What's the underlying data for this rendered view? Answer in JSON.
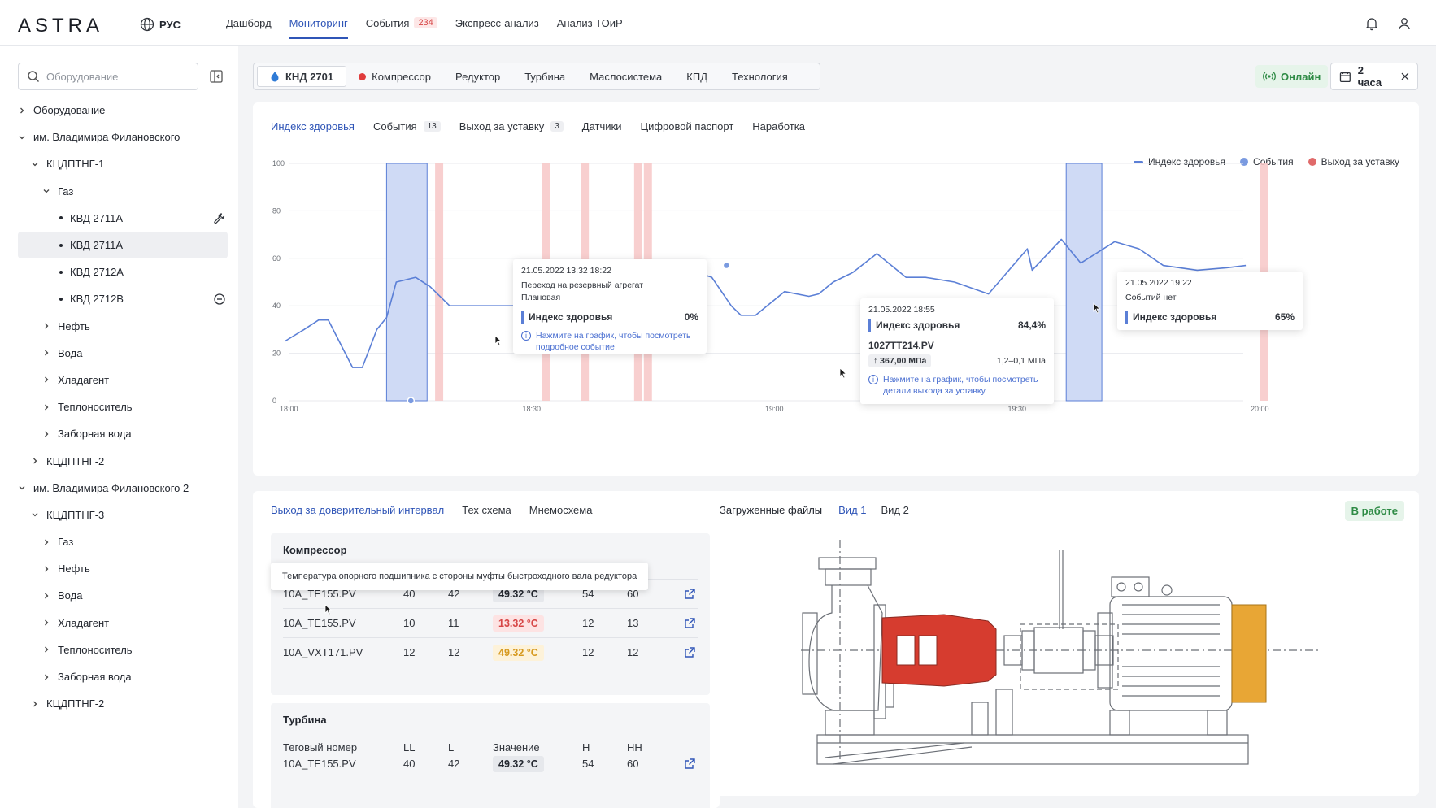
{
  "header": {
    "logo": "ASTRA",
    "lang": "РУС",
    "nav": [
      {
        "label": "Дашборд",
        "active": false
      },
      {
        "label": "Мониторинг",
        "active": true
      },
      {
        "label": "События",
        "badge": "234",
        "active": false
      },
      {
        "label": "Экспресс-анализ",
        "active": false
      },
      {
        "label": "Анализ ТОиР",
        "active": false
      }
    ],
    "icons": [
      "bell-icon",
      "user-icon"
    ]
  },
  "sidebar": {
    "search_placeholder": "Оборудование",
    "tree": [
      {
        "label": "Оборудование",
        "level": 0,
        "chev": "›"
      },
      {
        "label": "им. Владимира Филановского",
        "level": 0,
        "chev": "⌄"
      },
      {
        "label": "КЦДПТНГ-1",
        "level": 1,
        "chev": "⌄"
      },
      {
        "label": "Газ",
        "level": 2,
        "chev": "⌄"
      },
      {
        "label": "КВД 2711А",
        "level": 3,
        "dot": true,
        "icon": "wrench-icon"
      },
      {
        "label": "КВД 2711А",
        "level": 3,
        "dot": true,
        "selected": true
      },
      {
        "label": "КВД 2712А",
        "level": 3,
        "dot": true
      },
      {
        "label": "КВД 2712В",
        "level": 3,
        "dot": true,
        "icon": "minus-circle-icon"
      },
      {
        "label": "Нефть",
        "level": 2,
        "chev": "›"
      },
      {
        "label": "Вода",
        "level": 2,
        "chev": "›"
      },
      {
        "label": "Хладагент",
        "level": 2,
        "chev": "›"
      },
      {
        "label": "Теплоноситель",
        "level": 2,
        "chev": "›"
      },
      {
        "label": "Заборная вода",
        "level": 2,
        "chev": "›"
      },
      {
        "label": "КЦДПТНГ-2",
        "level": 1,
        "chev": "›"
      },
      {
        "label": "им. Владимира Филановского 2",
        "level": 0,
        "chev": "⌄"
      },
      {
        "label": "КЦДПТНГ-3",
        "level": 1,
        "chev": "⌄"
      },
      {
        "label": "Газ",
        "level": 2,
        "chev": "›"
      },
      {
        "label": "Нефть",
        "level": 2,
        "chev": "›"
      },
      {
        "label": "Вода",
        "level": 2,
        "chev": "›"
      },
      {
        "label": "Хладагент",
        "level": 2,
        "chev": "›"
      },
      {
        "label": "Теплоноситель",
        "level": 2,
        "chev": "›"
      },
      {
        "label": "Заборная вода",
        "level": 2,
        "chev": "›"
      },
      {
        "label": "КЦДПТНГ-2",
        "level": 1,
        "chev": "›"
      }
    ]
  },
  "equipment_tabs": [
    {
      "label": "КНД 2701",
      "active": true,
      "icon": "flame-icon"
    },
    {
      "label": "Компрессор",
      "icon": "red-dot-icon"
    },
    {
      "label": "Редуктор"
    },
    {
      "label": "Турбина"
    },
    {
      "label": "Маслосистема"
    },
    {
      "label": "КПД"
    },
    {
      "label": "Технология"
    }
  ],
  "status": {
    "online": "Онлайн",
    "period": "2 часа"
  },
  "chart_tabs": [
    {
      "label": "Индекс здоровья",
      "active": true
    },
    {
      "label": "События",
      "count": "13"
    },
    {
      "label": "Выход за уставку",
      "count": "3"
    },
    {
      "label": "Датчики"
    },
    {
      "label": "Цифровой паспорт"
    },
    {
      "label": "Наработка"
    }
  ],
  "legend": [
    {
      "label": "Индекс здоровья",
      "type": "line",
      "color": "#5b7fd6"
    },
    {
      "label": "События",
      "type": "dot",
      "color": "#7a9ae0"
    },
    {
      "label": "Выход за уставку",
      "type": "dot",
      "color": "#e06a6a"
    }
  ],
  "chart_data": {
    "type": "line",
    "x_ticks": [
      "18:00",
      "18:30",
      "19:00",
      "19:30",
      "20:00"
    ],
    "y_ticks": [
      "0",
      "20",
      "40",
      "60",
      "80",
      "100"
    ],
    "ylim": [
      0,
      100
    ],
    "xlim_minutes": [
      0,
      120
    ],
    "series": [
      {
        "name": "Индекс здоровья",
        "points": [
          [
            -1,
            25
          ],
          [
            3,
            30
          ],
          [
            6,
            34
          ],
          [
            8,
            34
          ],
          [
            13,
            14
          ],
          [
            15,
            14
          ],
          [
            18,
            30
          ],
          [
            20,
            35
          ],
          [
            22,
            50
          ],
          [
            26,
            52
          ],
          [
            29,
            48
          ],
          [
            33,
            40
          ],
          [
            51,
            40
          ],
          [
            56,
            45
          ],
          [
            59,
            47
          ],
          [
            63,
            52
          ],
          [
            65,
            56
          ],
          [
            70,
            53
          ],
          [
            74,
            46
          ],
          [
            77,
            49
          ],
          [
            80,
            41
          ],
          [
            84,
            54
          ],
          [
            87,
            52
          ],
          [
            91,
            40
          ],
          [
            93,
            36
          ],
          [
            96,
            36
          ],
          [
            99,
            41
          ],
          [
            102,
            46
          ],
          [
            107,
            44
          ],
          [
            109,
            45
          ],
          [
            112,
            50
          ],
          [
            115,
            53
          ],
          [
            116,
            54
          ],
          [
            121,
            62
          ],
          [
            127,
            52
          ],
          [
            131,
            52
          ],
          [
            137,
            50
          ],
          [
            144,
            45
          ],
          [
            152,
            64
          ],
          [
            153,
            55
          ],
          [
            159,
            68
          ],
          [
            163,
            58
          ],
          [
            170,
            67
          ],
          [
            175,
            64
          ],
          [
            180,
            57
          ],
          [
            187,
            55
          ],
          [
            193,
            56
          ],
          [
            197,
            57
          ]
        ]
      }
    ],
    "events_bands": [
      [
        20,
        25
      ],
      [
        160,
        164
      ]
    ],
    "setpoint_bands": [
      [
        30,
        31
      ],
      [
        52,
        53
      ],
      [
        60,
        61
      ],
      [
        71,
        72
      ],
      [
        73,
        74
      ],
      [
        200,
        201
      ]
    ],
    "event_markers": [
      [
        23,
        0
      ],
      [
        60,
        35
      ],
      [
        88,
        57
      ]
    ]
  },
  "tooltips": {
    "t1": {
      "date": "21.05.2022 13:32 18:22",
      "line1": "Переход на резервный агрегат",
      "line2": "Плановая",
      "metric": "Индекс здоровья",
      "value": "0%",
      "hint": "Нажмите на график, чтобы посмотреть подробное событие"
    },
    "t2": {
      "date": "21.05.2022 18:55",
      "metric": "Индекс здоровья",
      "value": "84,4%",
      "tag": "1027TT214.PV",
      "reading": "367,00 МПа",
      "range": "1,2–0,1 МПа",
      "hint": "Нажмите на график, чтобы посмотреть детали выхода за уставку"
    },
    "t3": {
      "date": "21.05.2022 19:22",
      "line1": "Событий нет",
      "metric": "Индекс здоровья",
      "value": "65%"
    }
  },
  "bottom_left": {
    "tabs": [
      {
        "label": "Выход за доверительный интервал",
        "active": true
      },
      {
        "label": "Тех схема"
      },
      {
        "label": "Мнемосхема"
      }
    ],
    "sensor_tooltip": "Температура опорного подшипника с стороны муфты быстроходного вала редуктора",
    "sections": [
      {
        "title": "Компрессор",
        "rows": [
          {
            "tag": "10A_TE155.PV",
            "ll": "40",
            "l": "42",
            "value": "49.32 °C",
            "tone": "gray",
            "h": "54",
            "hh": "60"
          },
          {
            "tag": "10A_TE155.PV",
            "ll": "10",
            "l": "11",
            "value": "13.32 °C",
            "tone": "red",
            "h": "12",
            "hh": "13"
          },
          {
            "tag": "10A_VXT171.PV",
            "ll": "12",
            "l": "12",
            "value": "49.32 °C",
            "tone": "yellow",
            "h": "12",
            "hh": "12"
          }
        ]
      },
      {
        "title": "Турбина",
        "header": {
          "tag": "Теговый номер",
          "ll": "LL",
          "l": "L",
          "value": "Значение",
          "h": "H",
          "hh": "HH"
        },
        "rows": [
          {
            "tag": "10A_TE155.PV",
            "ll": "40",
            "l": "42",
            "value": "49.32 °C",
            "tone": "gray",
            "h": "54",
            "hh": "60"
          }
        ]
      }
    ]
  },
  "bottom_right": {
    "tabs": [
      {
        "label": "Загруженные файлы",
        "active": false
      },
      {
        "label": "Вид 1",
        "active": true
      },
      {
        "label": "Вид 2",
        "active": false
      }
    ],
    "status": "В работе",
    "highlight_colors": {
      "pump": "#d63c2f",
      "motor": "#e8a635"
    }
  }
}
